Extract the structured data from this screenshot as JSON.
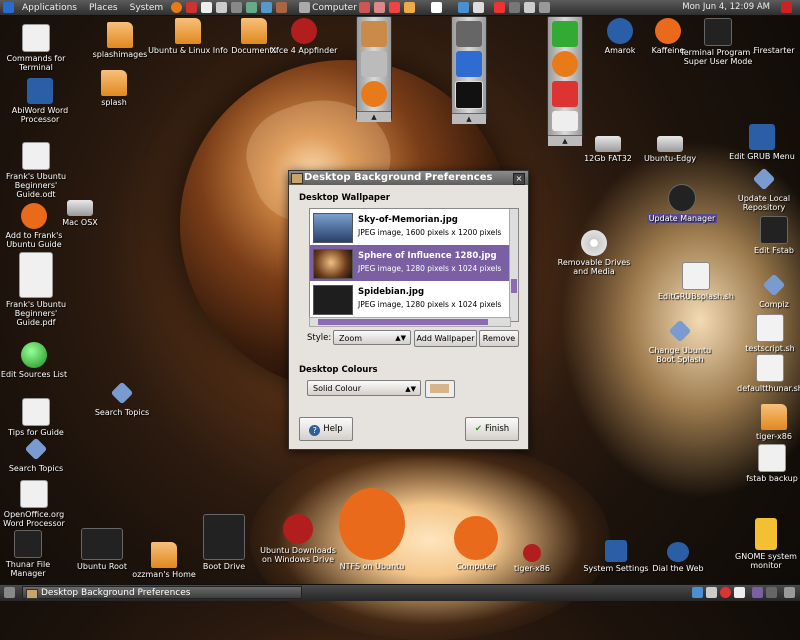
{
  "top_panel": {
    "menus": [
      "Applications",
      "Places",
      "System"
    ],
    "launcher_label": "Computer",
    "clock": "Mon Jun  4, 12:09 AM"
  },
  "desktop_icons": [
    {
      "label": "Commands for Terminal",
      "icon": "document-icon"
    },
    {
      "label": "AbiWord Word Processor",
      "icon": "abiword-icon"
    },
    {
      "label": "Frank's Ubuntu Beginners' Guide.odt",
      "icon": "document-icon"
    },
    {
      "label": "Add to Frank's Ubuntu Guide",
      "icon": "ubuntu-icon"
    },
    {
      "label": "Mac OSX",
      "icon": "drive-icon"
    },
    {
      "label": "Frank's Ubuntu Beginners' Guide.pdf",
      "icon": "pdf-icon"
    },
    {
      "label": "Edit Sources List",
      "icon": "globe-icon"
    },
    {
      "label": "Tips for Guide",
      "icon": "document-icon"
    },
    {
      "label": "Search Topics",
      "icon": "diamond-icon"
    },
    {
      "label": "Search Topics",
      "icon": "diamond-icon"
    },
    {
      "label": "OpenOffice.org Word Processor",
      "icon": "openoffice-icon"
    },
    {
      "label": "Thunar File Manager",
      "icon": "file-manager-icon"
    },
    {
      "label": "splashimages",
      "icon": "folder-icon"
    },
    {
      "label": "splash",
      "icon": "folder-icon"
    },
    {
      "label": "Ubuntu & Linux Info",
      "icon": "folder-icon"
    },
    {
      "label": "Documents",
      "icon": "folder-icon"
    },
    {
      "label": "Xfce 4 Appfinder",
      "icon": "appfinder-icon"
    },
    {
      "label": "Amarok",
      "icon": "amarok-icon"
    },
    {
      "label": "Kaffeine",
      "icon": "kaffeine-icon"
    },
    {
      "label": "Terminal Program - Super User Mode",
      "icon": "terminal-icon"
    },
    {
      "label": "Firestarter",
      "icon": "firestarter-icon"
    },
    {
      "label": "12Gb FAT32",
      "icon": "drive-icon"
    },
    {
      "label": "Ubuntu-Edgy",
      "icon": "drive-icon"
    },
    {
      "label": "Edit GRUB Menu",
      "icon": "grub-icon"
    },
    {
      "label": "Update Local Repository",
      "icon": "diamond-icon"
    },
    {
      "label": "Update Manager",
      "icon": "update-icon"
    },
    {
      "label": "Edit Fstab",
      "icon": "harddisk-icon"
    },
    {
      "label": "Removable Drives and Media",
      "icon": "cdrom-icon"
    },
    {
      "label": "EditGRUBsplash.sh",
      "icon": "script-icon"
    },
    {
      "label": "Compiz",
      "icon": "diamond-icon"
    },
    {
      "label": "Change Ubuntu Boot Splash",
      "icon": "diamond-icon"
    },
    {
      "label": "testscript.sh",
      "icon": "script-icon"
    },
    {
      "label": "defaultthunar.sh",
      "icon": "script-icon"
    },
    {
      "label": "tiger-x86",
      "icon": "folder-icon"
    },
    {
      "label": "fstab backup",
      "icon": "document-icon"
    },
    {
      "label": "Ubuntu Root",
      "icon": "harddisk-icon"
    },
    {
      "label": "ozzman's Home",
      "icon": "folder-icon"
    },
    {
      "label": "Boot Drive",
      "icon": "windows-drive-icon"
    },
    {
      "label": "Ubuntu Downloads on Windows Drive",
      "icon": "windows-drive-icon"
    },
    {
      "label": "NTFS on Ubuntu",
      "icon": "windows-ubuntu-icon"
    },
    {
      "label": "Computer",
      "icon": "ubuntu-icon"
    },
    {
      "label": "tiger-x86",
      "icon": "apple-icon"
    },
    {
      "label": "System Settings",
      "icon": "settings-icon"
    },
    {
      "label": "Dial the Web",
      "icon": "dialup-icon"
    },
    {
      "label": "GNOME system monitor",
      "icon": "monitor-icon"
    }
  ],
  "window": {
    "title": "Desktop Background Preferences",
    "wallpaper_section": "Desktop Wallpaper",
    "wallpapers": [
      {
        "name": "Sky-of-Memorian.jpg",
        "meta": "JPEG image, 1600 pixels x 1200 pixels",
        "selected": false,
        "thumb_color": "#3b5c8c"
      },
      {
        "name": "Sphere of Influence 1280.jpg",
        "meta": "JPEG image, 1280 pixels x 1024 pixels",
        "selected": true,
        "thumb_color": "#a86a30"
      },
      {
        "name": "Spidebian.jpg",
        "meta": "JPEG image, 1280 pixels x 1024 pixels",
        "selected": false,
        "thumb_color": "#1e1e1e"
      }
    ],
    "style_label": "Style:",
    "style_value": "Zoom",
    "add_wallpaper": "Add Wallpaper",
    "remove": "Remove",
    "colours_section": "Desktop Colours",
    "colour_mode": "Solid Colour",
    "colour_value": "#d9b48a",
    "help": "Help",
    "finish": "Finish"
  },
  "taskbar": {
    "active_task": "Desktop Background Preferences"
  },
  "colors": {
    "selection": "#7a5fa3",
    "panel": "#3a3a3a"
  }
}
